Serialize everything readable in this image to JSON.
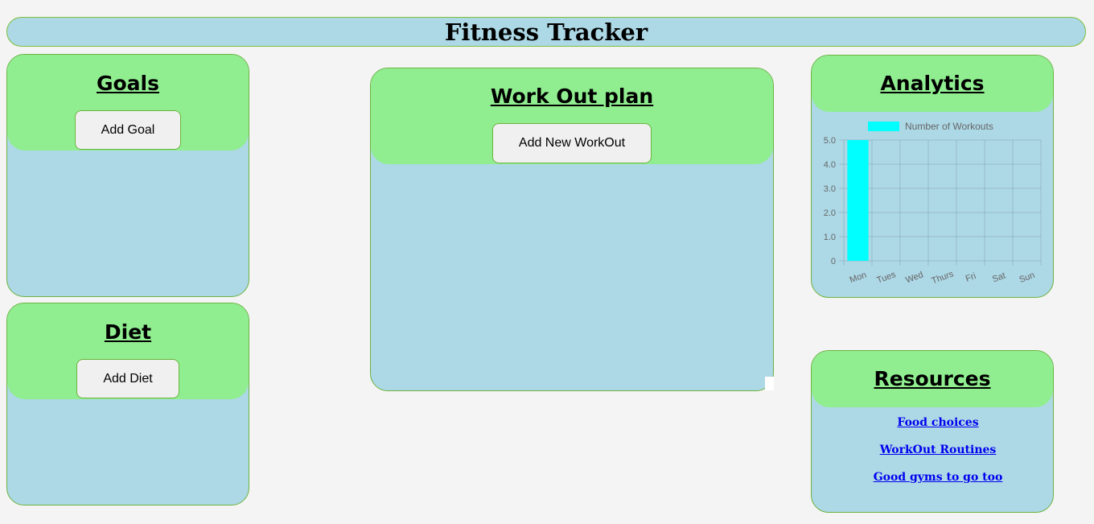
{
  "header": {
    "title": "Fitness Tracker"
  },
  "goals": {
    "title": "Goals",
    "button_label": "Add Goal"
  },
  "diet": {
    "title": "Diet",
    "button_label": "Add Diet"
  },
  "workout": {
    "title": "Work Out plan",
    "button_label": "Add New WorkOut"
  },
  "analytics": {
    "title": "Analytics"
  },
  "resources": {
    "title": "Resources",
    "links": [
      "Food choices",
      "WorkOut Routines",
      "Good gyms to go too"
    ]
  },
  "colors": {
    "card_background": "#add8e6",
    "card_header": "#90ee90",
    "border": "#6cb33f",
    "page_background": "#f4f4f4",
    "bar": "#00ffff",
    "link": "#0000ee"
  },
  "chart_data": {
    "type": "bar",
    "categories": [
      "Mon",
      "Tues",
      "Wed",
      "Thurs",
      "Fri",
      "Sat",
      "Sun"
    ],
    "series": [
      {
        "name": "Number of Workouts",
        "values": [
          5,
          0,
          0,
          0,
          0,
          0,
          0
        ]
      }
    ],
    "yticks": [
      "0",
      "1.0",
      "2.0",
      "3.0",
      "4.0",
      "5.0"
    ],
    "ylim": [
      0,
      5
    ],
    "grid": true,
    "legend": "top"
  }
}
